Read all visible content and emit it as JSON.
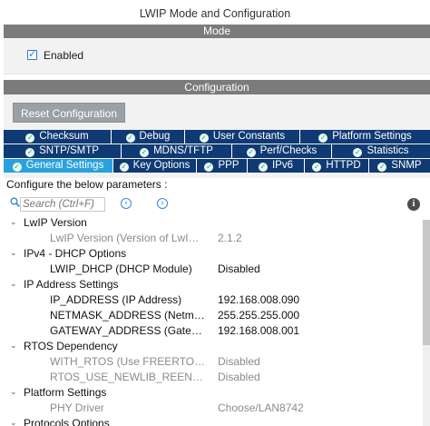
{
  "window": {
    "title": "LWIP Mode and Configuration"
  },
  "mode": {
    "header": "Mode",
    "enabled_label": "Enabled",
    "enabled_checked": true
  },
  "configuration": {
    "header": "Configuration",
    "reset_label": "Reset Configuration",
    "tabs_row1": [
      "Checksum",
      "Debug",
      "User Constants",
      "Platform Settings"
    ],
    "tabs_row2": [
      "SNTP/SMTP",
      "MDNS/TFTP",
      "Perf/Checks",
      "Statistics"
    ],
    "tabs_row3": [
      "General Settings",
      "Key Options",
      "PPP",
      "IPv6",
      "HTTPD",
      "SNMP"
    ],
    "active_tab": "General Settings",
    "params_label": "Configure the below parameters :",
    "search_placeholder": "Search (Ctrl+F)",
    "prev_icon": "circle-left-icon",
    "next_icon": "circle-right-icon",
    "info_icon": "info-icon"
  },
  "tree": {
    "groups": [
      {
        "name": "LwIP Version",
        "params": [
          {
            "name": "LwIP Version (Version of LwIP s...",
            "value": "2.1.2",
            "style": "grey"
          }
        ]
      },
      {
        "name": "IPv4 - DHCP Options",
        "params": [
          {
            "name": "LWIP_DHCP (DHCP Module)",
            "value": "Disabled",
            "style": "dark"
          }
        ]
      },
      {
        "name": "IP Address Settings",
        "params": [
          {
            "name": "IP_ADDRESS (IP Address)",
            "value": "192.168.008.090",
            "style": "dark"
          },
          {
            "name": "NETMASK_ADDRESS (Netmas...",
            "value": "255.255.255.000",
            "style": "dark"
          },
          {
            "name": "GATEWAY_ADDRESS (Gatewa...",
            "value": "192.168.008.001",
            "style": "dark"
          }
        ]
      },
      {
        "name": "RTOS Dependency",
        "params": [
          {
            "name": "WITH_RTOS (Use FREERTOS ...",
            "value": "Disabled",
            "style": "grey"
          },
          {
            "name": "RTOS_USE_NEWLIB_REENTR...",
            "value": "Disabled",
            "style": "grey"
          }
        ]
      },
      {
        "name": "Platform Settings",
        "params": [
          {
            "name": "PHY Driver",
            "value": "Choose/LAN8742",
            "style": "grey"
          }
        ]
      },
      {
        "name": "Protocols Options",
        "params": []
      }
    ]
  },
  "colors": {
    "tab_bg": "#103a73",
    "tab_active": "#2aa1dd",
    "header_bg": "#7b7b7b",
    "ok_green": "#1aa06c"
  }
}
